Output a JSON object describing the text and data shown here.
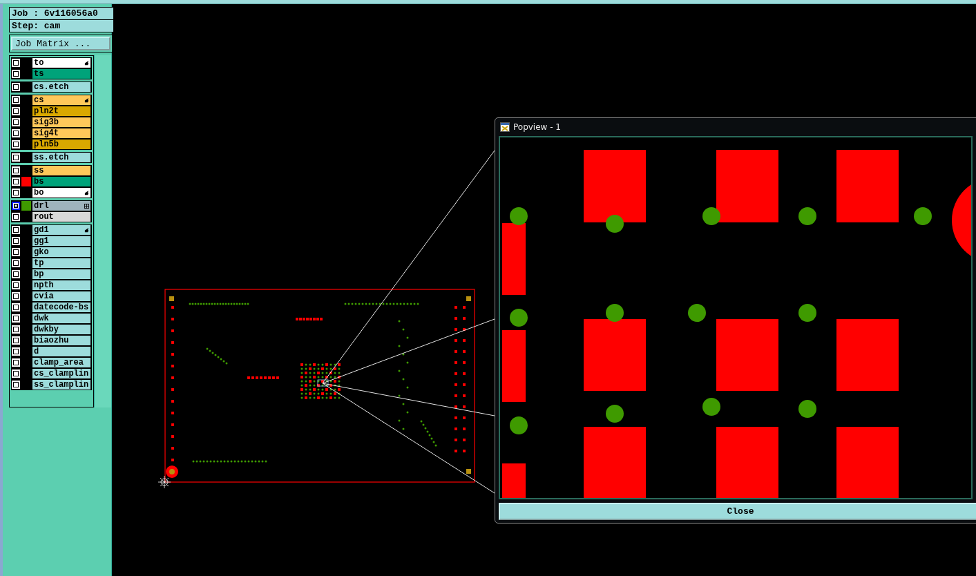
{
  "job": "Job : 6v116056a0",
  "step": "Step: cam",
  "job_matrix_button": "Job Matrix ...",
  "layer_groups": [
    {
      "layers": [
        {
          "name": "to",
          "color": "#ffffff",
          "selected": false,
          "kind": "work"
        },
        {
          "name": "ts",
          "color": "#00a37a",
          "selected": false,
          "kind": "plain"
        }
      ]
    },
    {
      "layers": [
        {
          "name": "cs.etch",
          "color": "#9ddcdc",
          "selected": false,
          "kind": "plain"
        }
      ]
    },
    {
      "layers": [
        {
          "name": "cs",
          "color": "#ffc85a",
          "selected": false,
          "kind": "work"
        },
        {
          "name": "pln2t",
          "color": "#d9a800",
          "selected": false,
          "kind": "plain"
        },
        {
          "name": "sig3b",
          "color": "#ffc85a",
          "selected": false,
          "kind": "plain"
        },
        {
          "name": "sig4t",
          "color": "#ffc85a",
          "selected": false,
          "kind": "plain"
        },
        {
          "name": "pln5b",
          "color": "#d9a800",
          "selected": false,
          "kind": "plain"
        }
      ]
    },
    {
      "layers": [
        {
          "name": "ss.etch",
          "color": "#9ddcdc",
          "selected": false,
          "kind": "plain"
        }
      ]
    },
    {
      "layers": [
        {
          "name": "ss",
          "color": "#ffc85a",
          "selected": false,
          "kind": "plain"
        },
        {
          "name": "bs",
          "color": "#00a37a",
          "selected": false,
          "kind": "plain",
          "display": {
            "color": "#ff0000"
          }
        },
        {
          "name": "bo",
          "color": "#ffffff",
          "selected": false,
          "kind": "work"
        }
      ]
    },
    {
      "layers": [
        {
          "name": "drl",
          "color": "#9fb4bc",
          "selected": true,
          "kind": "drill",
          "display": {
            "color": "#3f9a00"
          }
        },
        {
          "name": "rout",
          "color": "#d8d8d8",
          "selected": false,
          "kind": "plain"
        }
      ]
    },
    {
      "layers": [
        {
          "name": "gd1",
          "color": "#9ddcdc",
          "selected": false,
          "kind": "work"
        },
        {
          "name": "gg1",
          "color": "#9ddcdc",
          "selected": false,
          "kind": "plain"
        },
        {
          "name": "gko",
          "color": "#9ddcdc",
          "selected": false,
          "kind": "plain"
        },
        {
          "name": "tp",
          "color": "#9ddcdc",
          "selected": false,
          "kind": "plain"
        },
        {
          "name": "bp",
          "color": "#9ddcdc",
          "selected": false,
          "kind": "plain"
        },
        {
          "name": "npth",
          "color": "#9ddcdc",
          "selected": false,
          "kind": "plain"
        },
        {
          "name": "cvia",
          "color": "#9ddcdc",
          "selected": false,
          "kind": "plain"
        },
        {
          "name": "datecode-bs",
          "color": "#9ddcdc",
          "selected": false,
          "kind": "plain"
        },
        {
          "name": "dwk",
          "color": "#9ddcdc",
          "selected": false,
          "kind": "plain"
        },
        {
          "name": "dwkby",
          "color": "#9ddcdc",
          "selected": false,
          "kind": "plain"
        },
        {
          "name": "biaozhu",
          "color": "#9ddcdc",
          "selected": false,
          "kind": "plain"
        },
        {
          "name": "d",
          "color": "#9ddcdc",
          "selected": false,
          "kind": "plain"
        },
        {
          "name": "clamp_area",
          "color": "#9ddcdc",
          "selected": false,
          "kind": "plain"
        },
        {
          "name": "cs_clamplin",
          "color": "#9ddcdc",
          "selected": false,
          "kind": "plain"
        },
        {
          "name": "ss_clamplin",
          "color": "#9ddcdc",
          "selected": false,
          "kind": "plain"
        }
      ]
    }
  ],
  "popview": {
    "title": "Popview - 1",
    "close_button": "Close"
  }
}
